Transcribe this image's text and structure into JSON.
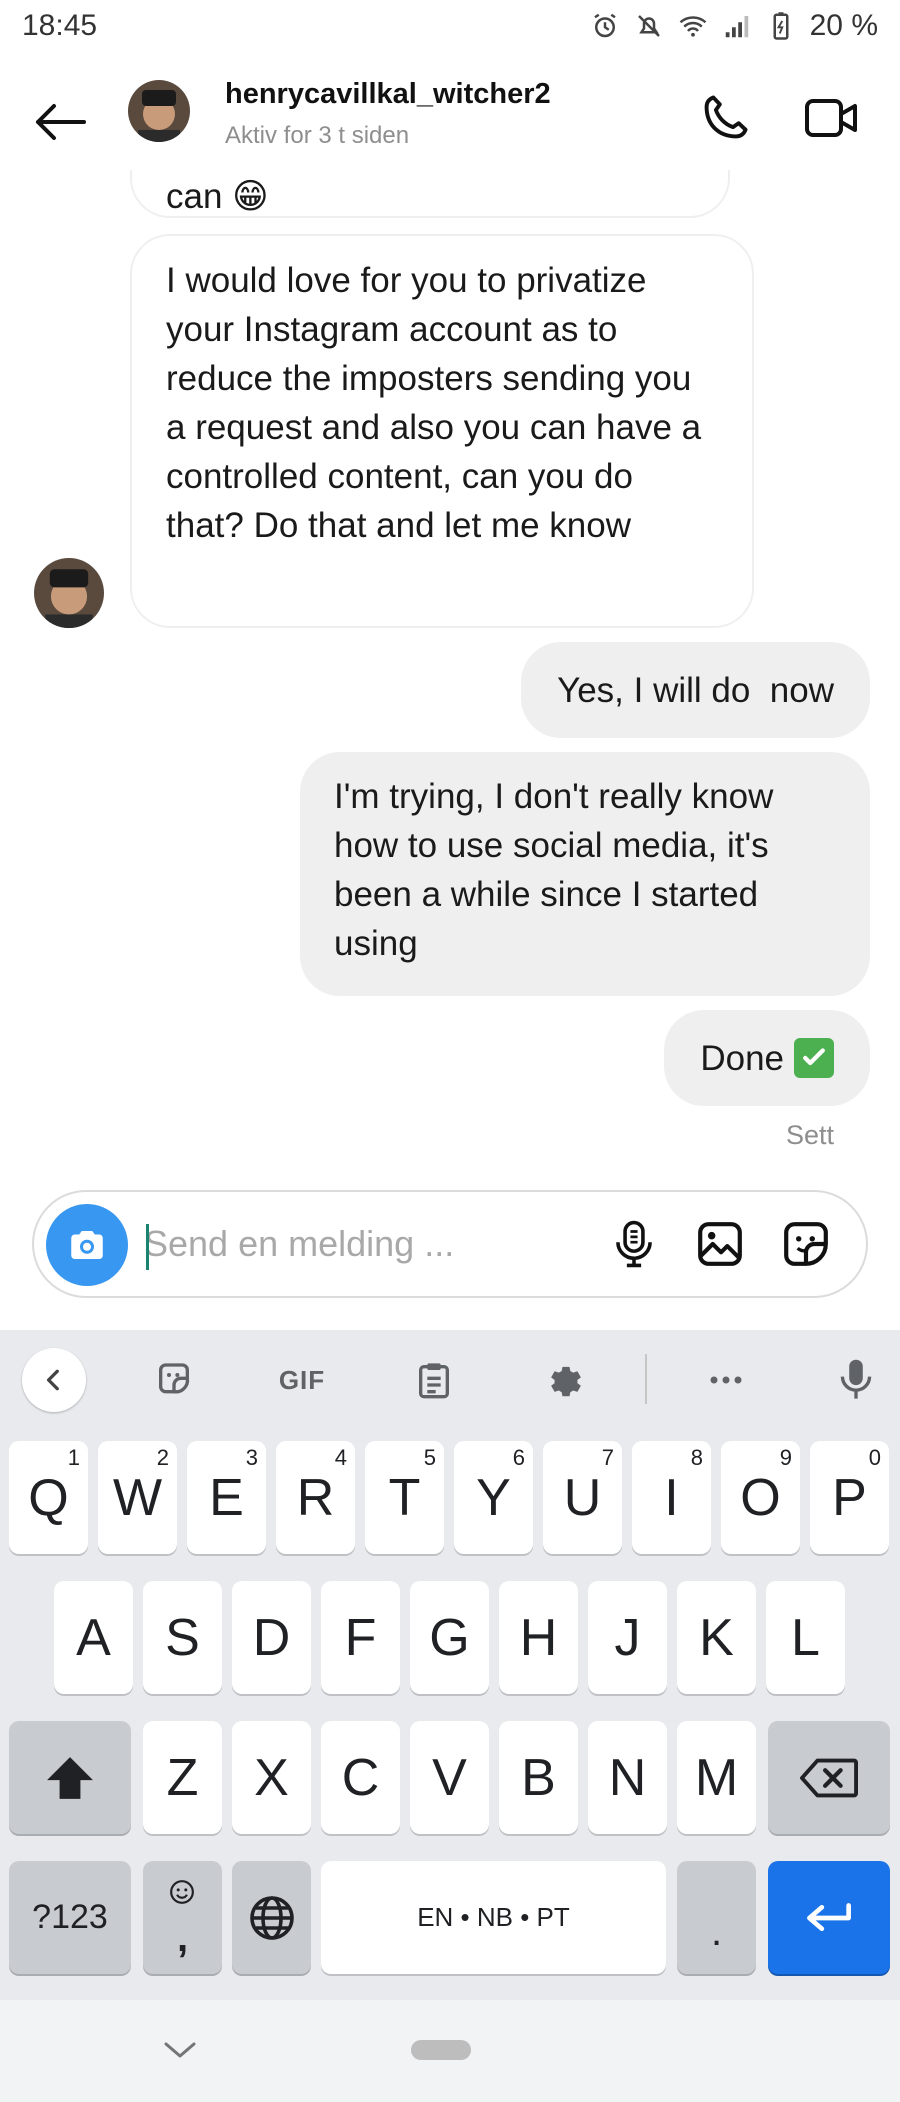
{
  "status_bar": {
    "time": "18:45",
    "battery": "20 %"
  },
  "header": {
    "username": "henrycavillkal_witcher2",
    "status": "Aktiv for 3 t siden"
  },
  "messages": {
    "partial_text": "can 😁",
    "long_incoming": "I would love for you to privatize your Instagram account as to reduce the imposters sending you a request and also you can have a controlled content, can you do that? Do that and let me know",
    "outgoing_yes": "Yes, I will do  now",
    "outgoing_trying": "I'm trying, I don't really know how to use social media, it's been a while since I started using",
    "outgoing_done": "Done",
    "seen_label": "Sett"
  },
  "composer": {
    "placeholder": "Send en melding ..."
  },
  "keyboard": {
    "toolbar": {
      "gif": "GIF"
    },
    "row1": [
      {
        "k": "Q",
        "h": "1"
      },
      {
        "k": "W",
        "h": "2"
      },
      {
        "k": "E",
        "h": "3"
      },
      {
        "k": "R",
        "h": "4"
      },
      {
        "k": "T",
        "h": "5"
      },
      {
        "k": "Y",
        "h": "6"
      },
      {
        "k": "U",
        "h": "7"
      },
      {
        "k": "I",
        "h": "8"
      },
      {
        "k": "O",
        "h": "9"
      },
      {
        "k": "P",
        "h": "0"
      }
    ],
    "row2": [
      "A",
      "S",
      "D",
      "F",
      "G",
      "H",
      "J",
      "K",
      "L"
    ],
    "row3": [
      "Z",
      "X",
      "C",
      "V",
      "B",
      "N",
      "M"
    ],
    "symbols_key": "?123",
    "comma_key": ",",
    "space_label": "EN • NB • PT",
    "period_key": "."
  }
}
